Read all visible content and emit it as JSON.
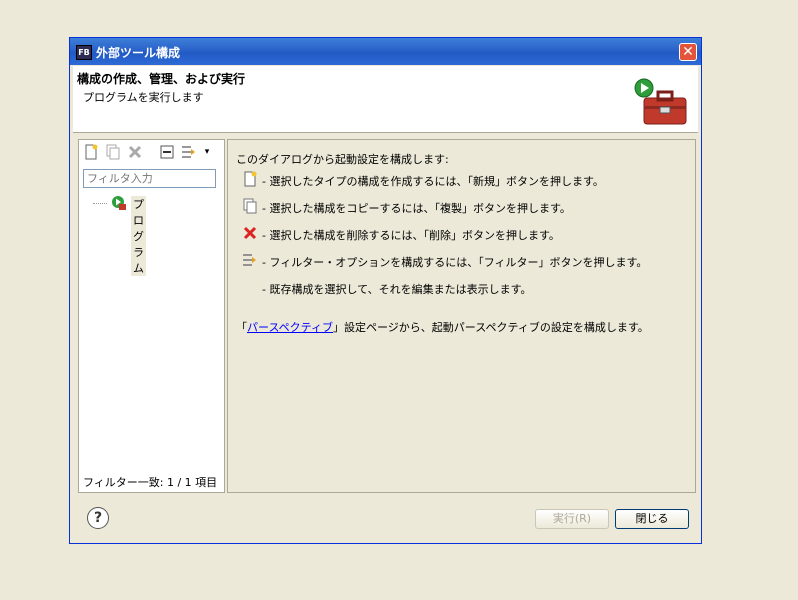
{
  "window": {
    "title": "外部ツール構成",
    "title_icon_text": "FB"
  },
  "header": {
    "title": "構成の作成、管理、および実行",
    "description": "プログラムを実行します"
  },
  "left": {
    "toolbar_icons": [
      "new-config-icon",
      "duplicate-icon",
      "delete-icon",
      "collapse-all-icon",
      "filter-icon"
    ],
    "filter_placeholder": "フィルタ入力",
    "tree": [
      {
        "label": "プログラム"
      }
    ],
    "status": "フィルター一致: 1 / 1 項目"
  },
  "right": {
    "intro": "このダイアログから起動設定を構成します:",
    "lines": [
      {
        "icon": "new-config-icon",
        "text": "- 選択したタイプの構成を作成するには、「新規」ボタンを押します。"
      },
      {
        "icon": "duplicate-icon",
        "text": "- 選択した構成をコピーするには、「複製」ボタンを押します。"
      },
      {
        "icon": "delete-icon",
        "text": "- 選択した構成を削除するには、「削除」ボタンを押します。"
      },
      {
        "icon": "filter-icon",
        "text": "- フィルター・オプションを構成するには、「フィルター」ボタンを押します。"
      },
      {
        "icon": "",
        "text": "- 既存構成を選択して、それを編集または表示します。"
      }
    ],
    "pref_prefix": "「",
    "pref_link": "パースペクティブ",
    "pref_suffix": "」設定ページから、起動パースペクティブの設定を構成します。"
  },
  "buttons": {
    "run": "実行(R)",
    "close": "閉じる"
  },
  "colors": {
    "title_bar": "#2a62c9",
    "link": "#0000ff",
    "delete_icon": "#d22"
  }
}
